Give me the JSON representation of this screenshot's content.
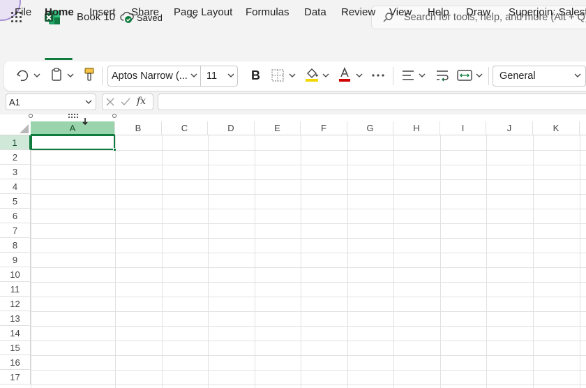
{
  "titlebar": {
    "book_title": "Book 10",
    "saved_status": "Saved",
    "search_placeholder": "Search for tools, help, and more (Alt + Q)"
  },
  "menu": {
    "tabs": [
      "File",
      "Home",
      "Insert",
      "Share",
      "Page Layout",
      "Formulas",
      "Data",
      "Review",
      "View",
      "Help",
      "Draw",
      "Superjoin: Salesforce"
    ],
    "active_tab": "Home"
  },
  "ribbon": {
    "font_name": "Aptos Narrow (...",
    "font_size": "11",
    "bold_label": "B",
    "number_format": "General"
  },
  "formula_bar": {
    "name_box": "A1",
    "fx_label": "fx",
    "formula_value": ""
  },
  "grid": {
    "columns": [
      "A",
      "B",
      "C",
      "D",
      "E",
      "F",
      "G",
      "H",
      "I",
      "J",
      "K"
    ],
    "rows": [
      "1",
      "2",
      "3",
      "4",
      "5",
      "6",
      "7",
      "8",
      "9",
      "10",
      "11",
      "12",
      "13",
      "14",
      "15",
      "16",
      "17"
    ],
    "selected_column": "A",
    "selected_row": "1"
  },
  "colors": {
    "accent": "#0f7b3c",
    "header_selected": "#9ad4ac",
    "fill_color_swatch": "#f2d600",
    "font_color_swatch": "#d00000"
  }
}
